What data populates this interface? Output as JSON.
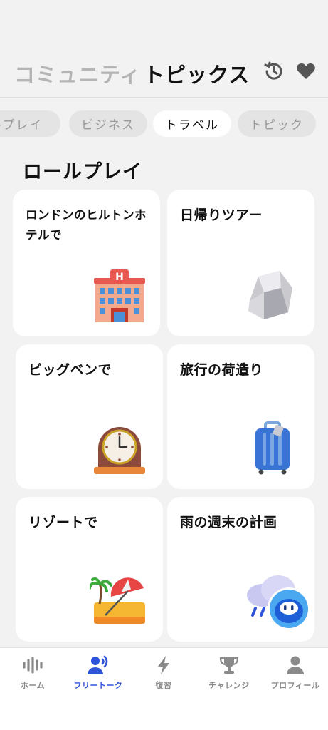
{
  "header": {
    "tabs": [
      {
        "label": "コミュニティ",
        "active": false
      },
      {
        "label": "トピックス",
        "active": true
      }
    ],
    "icons": [
      "history-icon",
      "heart-icon"
    ]
  },
  "categories": [
    {
      "label": "ルプレイ",
      "active": false
    },
    {
      "label": "ビジネス",
      "active": false
    },
    {
      "label": "トラベル",
      "active": true
    },
    {
      "label": "トピック",
      "active": false
    }
  ],
  "section": {
    "title": "ロールプレイ"
  },
  "cards": [
    {
      "title": "ロンドンのヒルトンホテルで",
      "icon": "hotel-icon"
    },
    {
      "title": "日帰りツアー",
      "icon": "rock-icon"
    },
    {
      "title": "ビッグベンで",
      "icon": "clock-icon"
    },
    {
      "title": "旅行の荷造り",
      "icon": "suitcase-icon"
    },
    {
      "title": "リゾートで",
      "icon": "beach-icon"
    },
    {
      "title": "雨の週末の計画",
      "icon": "rain-cloud-icon"
    }
  ],
  "bottom_nav": [
    {
      "label": "ホーム",
      "icon": "waveform-icon",
      "active": false
    },
    {
      "label": "フリートーク",
      "icon": "speaking-person-icon",
      "active": true
    },
    {
      "label": "復習",
      "icon": "lightning-icon",
      "active": false
    },
    {
      "label": "チャレンジ",
      "icon": "trophy-icon",
      "active": false
    },
    {
      "label": "プロフィール",
      "icon": "person-icon",
      "active": false
    }
  ],
  "colors": {
    "accent": "#2f54d9",
    "inactive": "#8a8a8a",
    "background": "#f2f2f2"
  }
}
